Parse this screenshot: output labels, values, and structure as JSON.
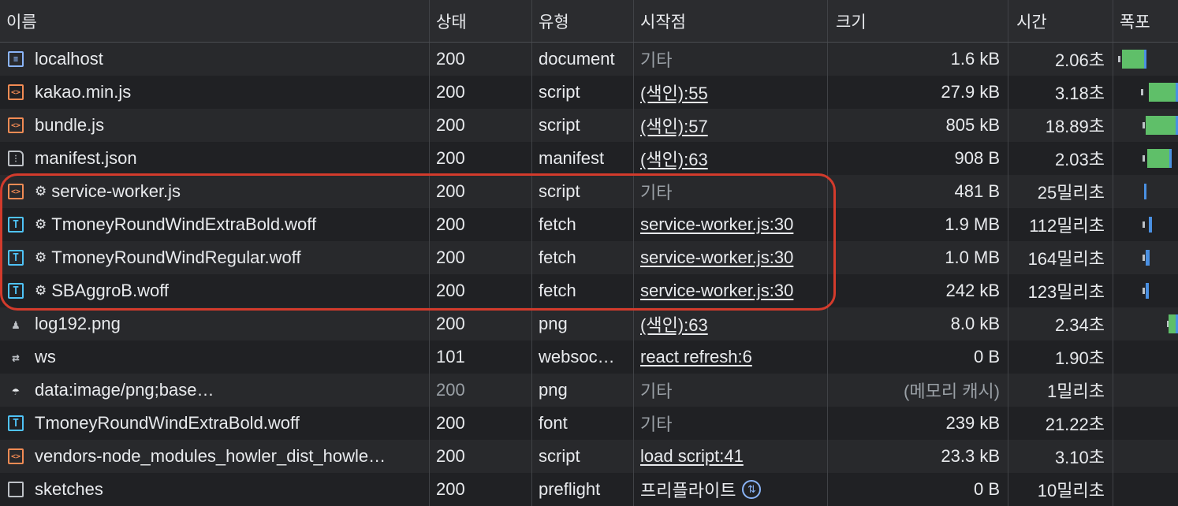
{
  "columns": {
    "name": "이름",
    "status": "상태",
    "type": "유형",
    "initiator": "시작점",
    "size": "크기",
    "time": "시간",
    "waterfall": "폭포"
  },
  "rows": [
    {
      "icon": "document-icon",
      "name": "localhost",
      "sw": false,
      "status": "200",
      "type": "document",
      "initiator": "기타",
      "initiator_link": false,
      "size": "1.6 kB",
      "time": "2.06초",
      "wf": {
        "tick": 0.02,
        "start": 0.14,
        "len": 0.38,
        "color": "#5fbf69"
      }
    },
    {
      "icon": "script-icon",
      "name": "kakao.min.js",
      "sw": false,
      "status": "200",
      "type": "script",
      "initiator": "(색인):55",
      "initiator_link": true,
      "size": "27.9 kB",
      "time": "3.18초",
      "wf": {
        "tick": 0.38,
        "start": 0.55,
        "len": 0.45,
        "color": "#5fbf69"
      }
    },
    {
      "icon": "script-icon",
      "name": "bundle.js",
      "sw": false,
      "status": "200",
      "type": "script",
      "initiator": "(색인):57",
      "initiator_link": true,
      "size": "805 kB",
      "time": "18.89초",
      "wf": {
        "tick": 0.4,
        "start": 0.5,
        "len": 0.5,
        "color": "#5fbf69"
      }
    },
    {
      "icon": "file-icon",
      "name": "manifest.json",
      "sw": false,
      "status": "200",
      "type": "manifest",
      "initiator": "(색인):63",
      "initiator_link": true,
      "size": "908 B",
      "time": "2.03초",
      "wf": {
        "tick": 0.4,
        "start": 0.52,
        "len": 0.38,
        "color": "#5fbf69"
      }
    },
    {
      "icon": "script-icon",
      "name": "service-worker.js",
      "sw": true,
      "status": "200",
      "type": "script",
      "initiator": "기타",
      "initiator_link": false,
      "size": "481 B",
      "time": "25밀리초",
      "wf": {
        "tick": null,
        "start": 0.47,
        "len": 0.04,
        "color": "#4a90e2"
      }
    },
    {
      "icon": "font-icon",
      "name": "TmoneyRoundWindExtraBold.woff",
      "sw": true,
      "status": "200",
      "type": "fetch",
      "initiator": "service-worker.js:30",
      "initiator_link": true,
      "size": "1.9 MB",
      "time": "112밀리초",
      "wf": {
        "tick": 0.4,
        "start": 0.55,
        "len": 0.05,
        "color": "#4a90e2"
      }
    },
    {
      "icon": "font-icon",
      "name": "TmoneyRoundWindRegular.woff",
      "sw": true,
      "status": "200",
      "type": "fetch",
      "initiator": "service-worker.js:30",
      "initiator_link": true,
      "size": "1.0 MB",
      "time": "164밀리초",
      "wf": {
        "tick": 0.4,
        "start": 0.5,
        "len": 0.06,
        "color": "#4a90e2"
      }
    },
    {
      "icon": "font-icon",
      "name": "SBAggroB.woff",
      "sw": true,
      "status": "200",
      "type": "fetch",
      "initiator": "service-worker.js:30",
      "initiator_link": true,
      "size": "242 kB",
      "time": "123밀리초",
      "wf": {
        "tick": 0.4,
        "start": 0.5,
        "len": 0.05,
        "color": "#4a90e2"
      }
    },
    {
      "icon": "image-icon",
      "name": "log192.png",
      "sw": false,
      "status": "200",
      "type": "png",
      "initiator": "(색인):63",
      "initiator_link": true,
      "size": "8.0 kB",
      "time": "2.34초",
      "wf": {
        "tick": 0.78,
        "start": 0.85,
        "len": 0.15,
        "color": "#5fbf69"
      }
    },
    {
      "icon": "websocket-icon",
      "name": "ws",
      "sw": false,
      "status": "101",
      "type": "websoc…",
      "initiator": "react refresh:6",
      "initiator_link": true,
      "size": "0 B",
      "time": "1.90초",
      "wf": null
    },
    {
      "icon": "data-icon",
      "name": "data:image/png;base…",
      "sw": false,
      "status": "200",
      "status_dim": true,
      "type": "png",
      "initiator": "기타",
      "initiator_link": false,
      "size": "(메모리 캐시)",
      "size_dim": true,
      "time": "1밀리초",
      "wf": null
    },
    {
      "icon": "font-icon",
      "name": "TmoneyRoundWindExtraBold.woff",
      "sw": false,
      "status": "200",
      "type": "font",
      "initiator": "기타",
      "initiator_link": false,
      "size": "239 kB",
      "time": "21.22초",
      "wf": null
    },
    {
      "icon": "script-icon",
      "name": "vendors-node_modules_howler_dist_howle…",
      "sw": false,
      "status": "200",
      "type": "script",
      "initiator": "load script:41",
      "initiator_link": true,
      "size": "23.3 kB",
      "time": "3.10초",
      "wf": null
    },
    {
      "icon": "checkbox-icon",
      "name": "sketches",
      "sw": false,
      "status": "200",
      "type": "preflight",
      "initiator": "프리플라이트",
      "initiator_link": false,
      "initiator_icon": true,
      "size": "0 B",
      "time": "10밀리초",
      "wf": null
    }
  ]
}
